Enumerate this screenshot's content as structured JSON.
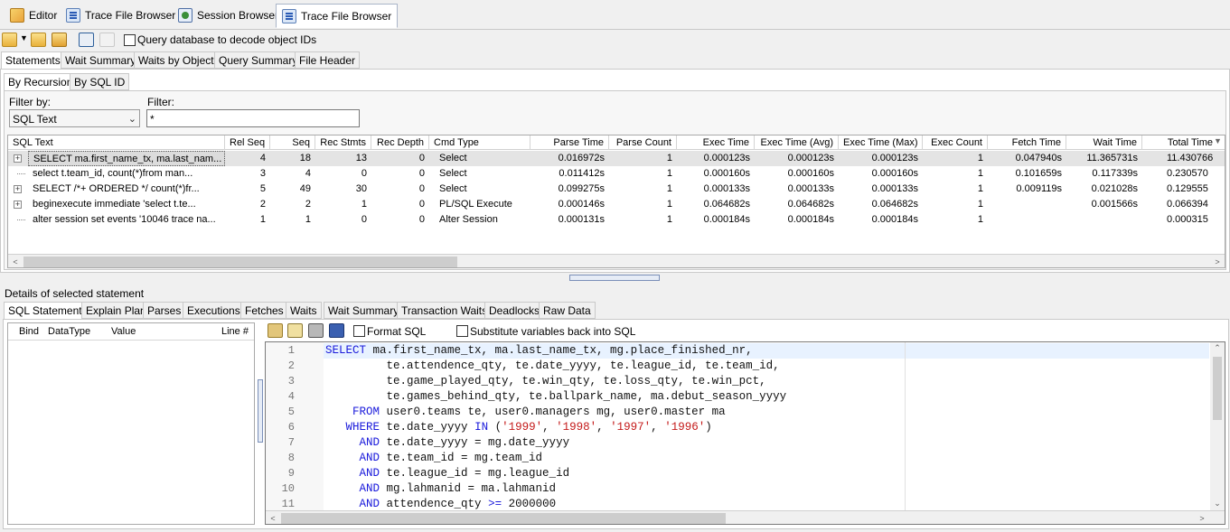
{
  "doc_tabs": [
    {
      "label": "Editor",
      "icon": "editor-icon"
    },
    {
      "label": "Trace File Browser",
      "icon": "trace-file-icon"
    },
    {
      "label": "Session Browser",
      "icon": "session-browser-icon"
    },
    {
      "label": "Trace File Browser",
      "icon": "trace-file-icon"
    }
  ],
  "toolbar": {
    "decode_label": "Query database to decode object IDs"
  },
  "main_tabs": [
    "Statements",
    "Wait Summary",
    "Waits by Object",
    "Query Summary",
    "File Header"
  ],
  "sub_tabs": [
    "By Recursion",
    "By SQL ID"
  ],
  "filter": {
    "filter_by_label": "Filter by:",
    "filter_by_value": "SQL Text",
    "filter_label": "Filter:",
    "filter_value": "*"
  },
  "grid": {
    "columns": [
      "SQL Text",
      "Rel Seq",
      "Seq",
      "Rec Stmts",
      "Rec Depth",
      "Cmd Type",
      "Parse Time",
      "Parse Count",
      "Exec Time",
      "Exec Time (Avg)",
      "Exec Time (Max)",
      "Exec Count",
      "Fetch Time",
      "Wait Time",
      "Total Time"
    ],
    "rows": [
      {
        "sql": "SELECT ma.first_name_tx, ma.last_nam...",
        "rel_seq": "4",
        "seq": "18",
        "rec_stmts": "13",
        "rec_depth": "0",
        "cmd": "Select",
        "parse_time": "0.016972s",
        "parse_count": "1",
        "exec_time": "0.000123s",
        "exec_avg": "0.000123s",
        "exec_max": "0.000123s",
        "exec_count": "1",
        "fetch_time": "0.047940s",
        "wait_time": "11.365731s",
        "total_time": "11.430766",
        "expandable": "+"
      },
      {
        "sql": "select t.team_id, count(*)from  man...",
        "rel_seq": "3",
        "seq": "4",
        "rec_stmts": "0",
        "rec_depth": "0",
        "cmd": "Select",
        "parse_time": "0.011412s",
        "parse_count": "1",
        "exec_time": "0.000160s",
        "exec_avg": "0.000160s",
        "exec_max": "0.000160s",
        "exec_count": "1",
        "fetch_time": "0.101659s",
        "wait_time": "0.117339s",
        "total_time": "0.230570",
        "expandable": ""
      },
      {
        "sql": "SELECT /*+ ORDERED */ count(*)fr...",
        "rel_seq": "5",
        "seq": "49",
        "rec_stmts": "30",
        "rec_depth": "0",
        "cmd": "Select",
        "parse_time": "0.099275s",
        "parse_count": "1",
        "exec_time": "0.000133s",
        "exec_avg": "0.000133s",
        "exec_max": "0.000133s",
        "exec_count": "1",
        "fetch_time": "0.009119s",
        "wait_time": "0.021028s",
        "total_time": "0.129555",
        "expandable": "+"
      },
      {
        "sql": "beginexecute immediate 'select t.te...",
        "rel_seq": "2",
        "seq": "2",
        "rec_stmts": "1",
        "rec_depth": "0",
        "cmd": "PL/SQL Execute",
        "parse_time": "0.000146s",
        "parse_count": "1",
        "exec_time": "0.064682s",
        "exec_avg": "0.064682s",
        "exec_max": "0.064682s",
        "exec_count": "1",
        "fetch_time": "",
        "wait_time": "0.001566s",
        "total_time": "0.066394",
        "expandable": "+"
      },
      {
        "sql": "alter session set events '10046 trace na...",
        "rel_seq": "1",
        "seq": "1",
        "rec_stmts": "0",
        "rec_depth": "0",
        "cmd": "Alter Session",
        "parse_time": "0.000131s",
        "parse_count": "1",
        "exec_time": "0.000184s",
        "exec_avg": "0.000184s",
        "exec_max": "0.000184s",
        "exec_count": "1",
        "fetch_time": "",
        "wait_time": "",
        "total_time": "0.000315",
        "expandable": ""
      }
    ]
  },
  "details": {
    "title": "Details of selected statement",
    "tabs": [
      "SQL Statement",
      "Explain Plan",
      "Parses",
      "Executions",
      "Fetches",
      "Waits",
      "Wait Summary",
      "Transaction Waits",
      "Deadlocks",
      "Raw Data"
    ],
    "bind_columns": [
      "Bind",
      "DataType",
      "Value",
      "Line #"
    ],
    "format_sql_label": "Format SQL",
    "substitute_label": "Substitute variables back into SQL"
  },
  "sql_lines": [
    "1",
    "2",
    "3",
    "4",
    "5",
    "6",
    "7",
    "8",
    "9",
    "10",
    "11"
  ]
}
